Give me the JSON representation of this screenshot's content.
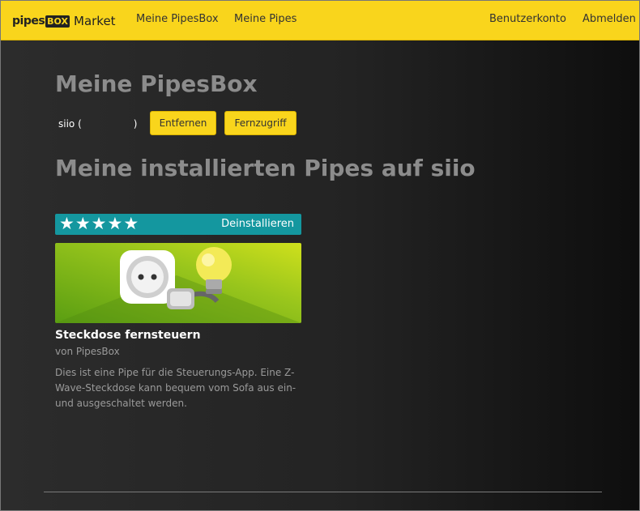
{
  "navbar": {
    "logo_pipes": "pipes",
    "logo_box": "BOX",
    "logo_market": "Market",
    "links": [
      "Meine PipesBox",
      "Meine Pipes"
    ],
    "right_links": [
      "Benutzerkonto",
      "Abmelden"
    ],
    "accent_color": "#f9d51c"
  },
  "main": {
    "title": "Meine PipesBox",
    "device": {
      "name": "siio (",
      "close": ")"
    },
    "buttons": {
      "remove": "Entfernen",
      "remote": "Fernzugriff"
    },
    "installed_title": "Meine installierten Pipes auf siio"
  },
  "pipe_card": {
    "rating": 5,
    "rating_max": 5,
    "star_glyph": "★",
    "uninstall_label": "Deinstallieren",
    "image_icons": [
      "power-socket-icon",
      "plug-icon",
      "light-bulb-icon"
    ],
    "title": "Steckdose fernsteuern",
    "author": "von PipesBox",
    "description": "Dies ist eine Pipe für die Steuerungs-App. Eine Z-Wave-Steckdose kann bequem vom Sofa aus ein- und ausgeschaltet werden.",
    "banner_color": "#14979f",
    "image_color": "#8dc21f"
  }
}
